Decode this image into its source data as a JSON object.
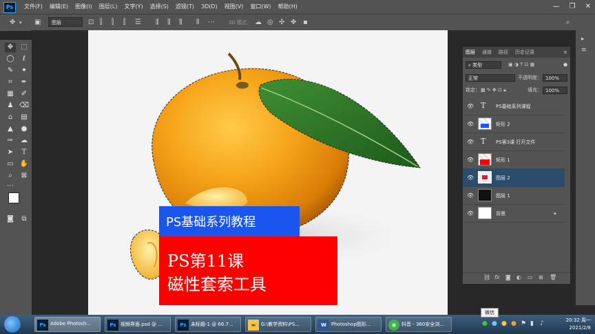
{
  "menu": {
    "logo": "Ps",
    "items": [
      "文件(F)",
      "编辑(E)",
      "图像(I)",
      "图层(L)",
      "文字(Y)",
      "选择(S)",
      "滤镜(T)",
      "3D(D)",
      "视图(V)",
      "窗口(W)",
      "帮助(H)"
    ],
    "minimize": "—",
    "restore": "❐",
    "close": "✕"
  },
  "options": {
    "layer_select": "图层",
    "mode_3d": "3D 模式："
  },
  "canvas": {
    "title_banner": "PS基础系列教程",
    "lesson_line1": "PS第11课",
    "lesson_line2": "磁性套索工具"
  },
  "layers_panel": {
    "tabs": [
      "图层",
      "通道",
      "路径",
      "历史记录"
    ],
    "filter_label": "类型",
    "blend_mode": "正常",
    "opacity_label": "不透明度：",
    "opacity_value": "100%",
    "lock_label": "锁定：",
    "fill_label": "填充：",
    "fill_value": "100%",
    "layers": [
      {
        "name": "PS基础系列课程",
        "kind": "text"
      },
      {
        "name": "矩形 2",
        "kind": "shape"
      },
      {
        "name": "PS第3课 打开文件",
        "kind": "text"
      },
      {
        "name": "矩形 1",
        "kind": "shape"
      },
      {
        "name": "图层 2",
        "kind": "pixel",
        "selected": true
      },
      {
        "name": "图层 1",
        "kind": "dark"
      },
      {
        "name": "背景",
        "kind": "background",
        "locked": true
      }
    ],
    "footer_fx": "fx"
  },
  "taskbar": {
    "tasks": [
      {
        "label": "Adobe Photosh...",
        "icon": "Ps"
      },
      {
        "label": "视频界面.psd @ ...",
        "icon": "Ps"
      },
      {
        "label": "未标题-1 @ 66.7...",
        "icon": "Ps"
      },
      {
        "label": "G:\\教学资料\\PS...",
        "icon": "folder"
      },
      {
        "label": "Photoshop图形...",
        "icon": "W"
      },
      {
        "label": "抖音 - 360安全浏...",
        "icon": "360"
      }
    ],
    "tooltip": "微信",
    "time": "20:32 周一",
    "date": "2021/2/8"
  },
  "colors": {
    "blue_banner": "#1a55f0",
    "red_banner": "#ff0000",
    "ui_panel": "#535353",
    "selected_layer": "#2a4d6d"
  }
}
